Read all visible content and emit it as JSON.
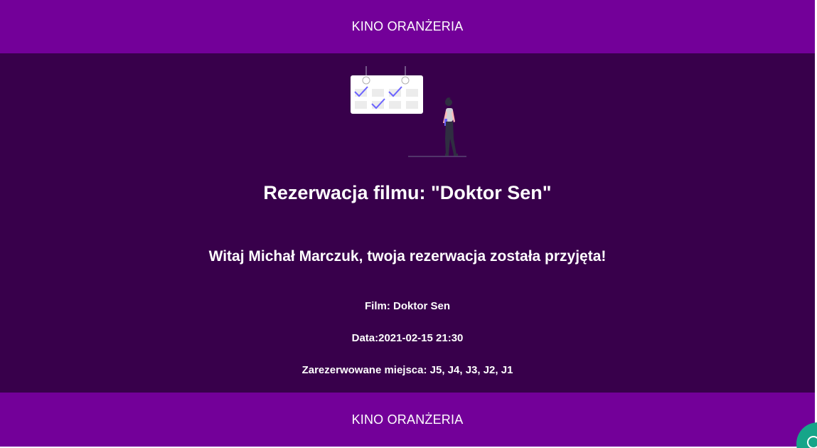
{
  "header": {
    "title": "KINO ORANŻERIA"
  },
  "reservation": {
    "title": "Rezerwacja filmu: \"Doktor Sen\"",
    "greeting": "Witaj Michał Marczuk, twoja rezerwacja została przyjęta!",
    "film": "Film: Doktor Sen",
    "date": "Data:2021-02-15 21:30",
    "seats": "Zarezerwowane miejsca: J5, J4, J3, J2, J1"
  },
  "footer": {
    "title": "KINO ORANŻERIA"
  },
  "icons": {
    "illustration": "calendar-booking-illustration",
    "chat": "chat-icon"
  },
  "colors": {
    "bar": "#730099",
    "main_bg": "#38004b",
    "accent": "#6c63ff",
    "chat": "#16a589"
  }
}
